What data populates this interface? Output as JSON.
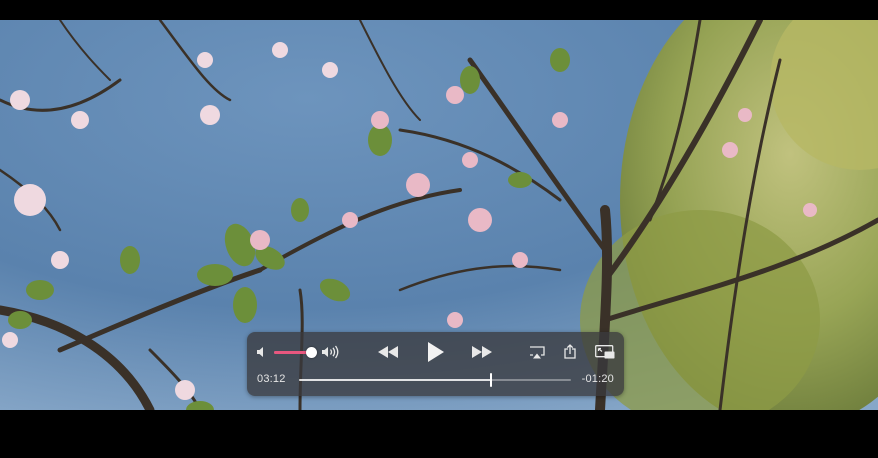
{
  "player": {
    "current_time": "03:12",
    "remaining_time": "-01:20",
    "progress": 0.706,
    "volume": 0.88,
    "is_playing": false,
    "accent_color": "#e8577f"
  },
  "controls": {
    "icons": [
      "volume-low-icon",
      "volume-high-icon",
      "rewind-icon",
      "play-icon",
      "fast-forward-icon",
      "airplay-icon",
      "share-icon",
      "picture-in-picture-icon"
    ]
  }
}
